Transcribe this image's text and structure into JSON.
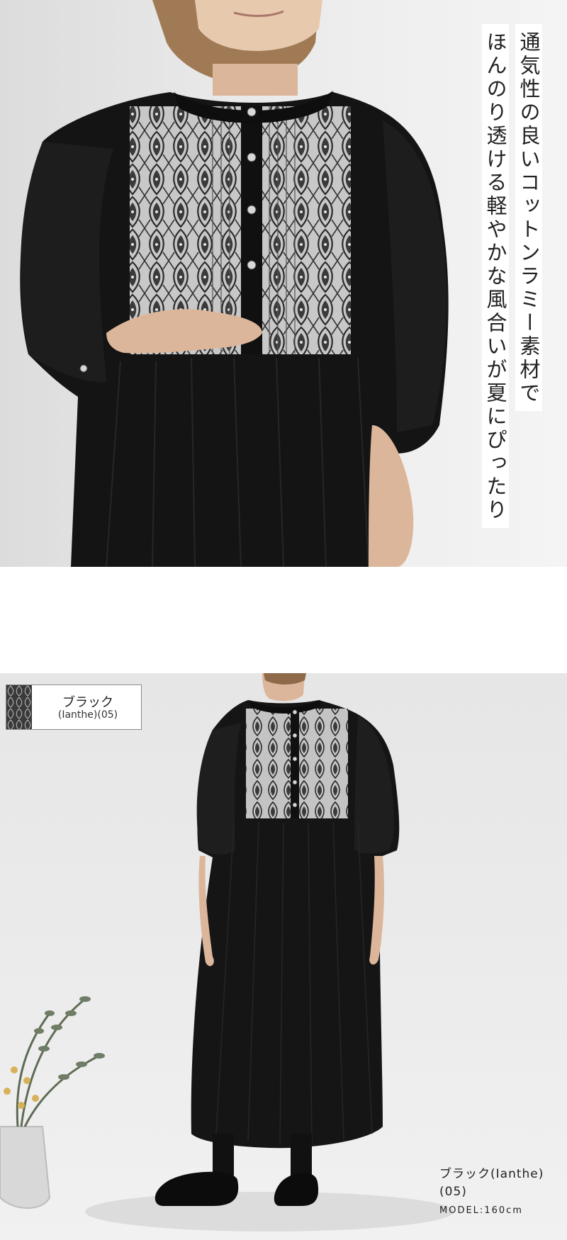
{
  "top_section": {
    "headline_col1": "通気性の良いコットンラミー素材で",
    "headline_col2": "ほんのり透ける軽やかな風合いが夏にぴったり"
  },
  "bottom_section": {
    "swatch": {
      "color_name": "ブラック",
      "pattern_code": "(Ianthe)(05)"
    },
    "caption": {
      "line1": "ブラック(Ianthe)",
      "line2": "(05)",
      "model": "MODEL:160cm"
    }
  },
  "colors": {
    "dress": "#151515",
    "print_panel": "#b9b9b9",
    "background": "#ffffff"
  }
}
